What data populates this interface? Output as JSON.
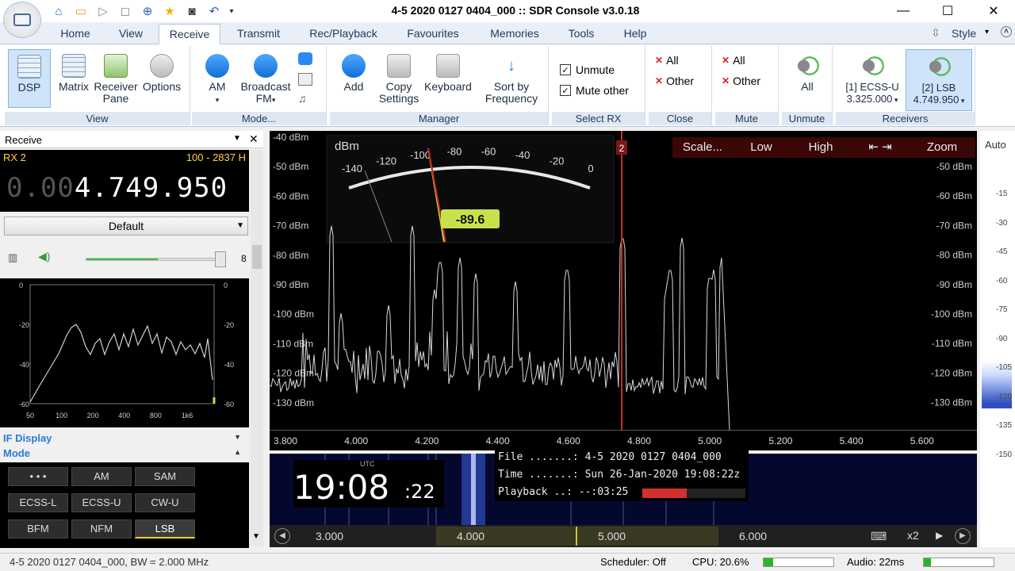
{
  "window": {
    "title": "4-5 2020 0127 0404_000 :: SDR Console v3.0.18",
    "minimize": "—",
    "maximize": "☐",
    "close": "✕"
  },
  "tabs": [
    "Home",
    "View",
    "Receive",
    "Transmit",
    "Rec/Playback",
    "Favourites",
    "Memories",
    "Tools",
    "Help"
  ],
  "active_tab": "Receive",
  "style_label": "Style",
  "ribbon": {
    "view_group": {
      "label": "View",
      "buttons": [
        "DSP",
        "Matrix",
        "Receiver",
        "Pane",
        "Options"
      ]
    },
    "mode_group": {
      "label": "Mode...",
      "am": "AM",
      "broadcast": "Broadcast",
      "fm": "FM"
    },
    "manager_group": {
      "label": "Manager",
      "add": "Add",
      "copy": "Copy",
      "settings": "Settings",
      "keyboard": "Keyboard",
      "sort": "Sort by",
      "frequency": "Frequency"
    },
    "select_rx_group": {
      "label": "Select RX",
      "unmute": "Unmute",
      "mute_other": "Mute other"
    },
    "close_group": {
      "label": "Close",
      "all": "All",
      "other": "Other"
    },
    "mute_group": {
      "label": "Mute",
      "all": "All",
      "other": "Other"
    },
    "unmute_group": {
      "label": "Unmute",
      "all": "All"
    },
    "receivers_group": {
      "label": "Receivers",
      "rx1_line1": "[1]  ECSS-U",
      "rx1_line2": "3.325.000",
      "rx2_line1": "[2]  LSB",
      "rx2_line2": "4.749.950"
    }
  },
  "left_panel": {
    "header": "Receive",
    "rx_label": "RX 2",
    "bw_label": "100 - 2837 H",
    "freq_dim": "0.00",
    "freq_main": "4.749.950",
    "preset": "Default",
    "volume_value": "8",
    "volume_level": 0.55,
    "audio_y_left": [
      "0",
      "-20",
      "-40",
      "-60"
    ],
    "audio_y_right": [
      "0",
      "-20",
      "-40",
      "-60"
    ],
    "audio_x": [
      "50",
      "100",
      "200",
      "400",
      "800",
      "1k6"
    ],
    "if_display": "IF Display",
    "mode_header": "Mode",
    "modes": [
      "• • •",
      "AM",
      "SAM",
      "ECSS-L",
      "ECSS-U",
      "CW-U",
      "BFM",
      "NFM",
      "LSB"
    ],
    "selected_mode": "LSB"
  },
  "spectrum": {
    "y_left": [
      "-40 dBm",
      "-50 dBm",
      "-60 dBm",
      "-70 dBm",
      "-80 dBm",
      "-90 dBm",
      "-100 dBm",
      "-110 dBm",
      "-120 dBm",
      "-130 dBm"
    ],
    "y_right": [
      "-50 dBm",
      "-60 dBm",
      "-70 dBm",
      "-80 dBm",
      "-90 dBm",
      "-100 dBm",
      "-110 dBm",
      "-120 dBm",
      "-130 dBm"
    ],
    "x_labels": [
      "3.800",
      "4.000",
      "4.200",
      "4.400",
      "4.600",
      "4.800",
      "5.000",
      "5.200",
      "5.400",
      "5.600"
    ],
    "toolbar": [
      "Scale...",
      "Low",
      "High",
      "⇤  ⇥",
      "Zoom"
    ],
    "marker_label": "2",
    "meter_unit": "dBm",
    "meter_ticks": [
      "-140",
      "-120",
      "-100",
      "-80",
      "-60",
      "-40",
      "-20",
      "0"
    ],
    "meter_value": "-89.6"
  },
  "waterfall": {
    "utc": "UTC",
    "time_big": "19:08",
    "time_sec": ":22",
    "file_line": "File .......: 4-5 2020 0127 0404_000",
    "time_line": "Time .......: Sun 26-Jan-2020 19:08:22z",
    "playback_line": "Playback ..: --:03:25",
    "x_labels": [
      "3.000",
      "4.000",
      "5.000",
      "6.000"
    ],
    "zoom": "x2"
  },
  "right_scale": {
    "auto": "Auto",
    "ticks": [
      "-15",
      "-30",
      "-45",
      "-60",
      "-75",
      "-90",
      "-105",
      "-120",
      "-135",
      "-150"
    ]
  },
  "status": {
    "left": "4-5 2020 0127 0404_000, BW = 2.000 MHz",
    "scheduler": "Scheduler: Off",
    "cpu": "CPU: 20.6%",
    "audio": "Audio: 22ms"
  },
  "colors": {
    "accent": "#2b79d4",
    "trace": "#d8d8d8",
    "marker": "#c0312b",
    "meter_box": "#c8e04a",
    "freq_label": "#ffd24a"
  }
}
